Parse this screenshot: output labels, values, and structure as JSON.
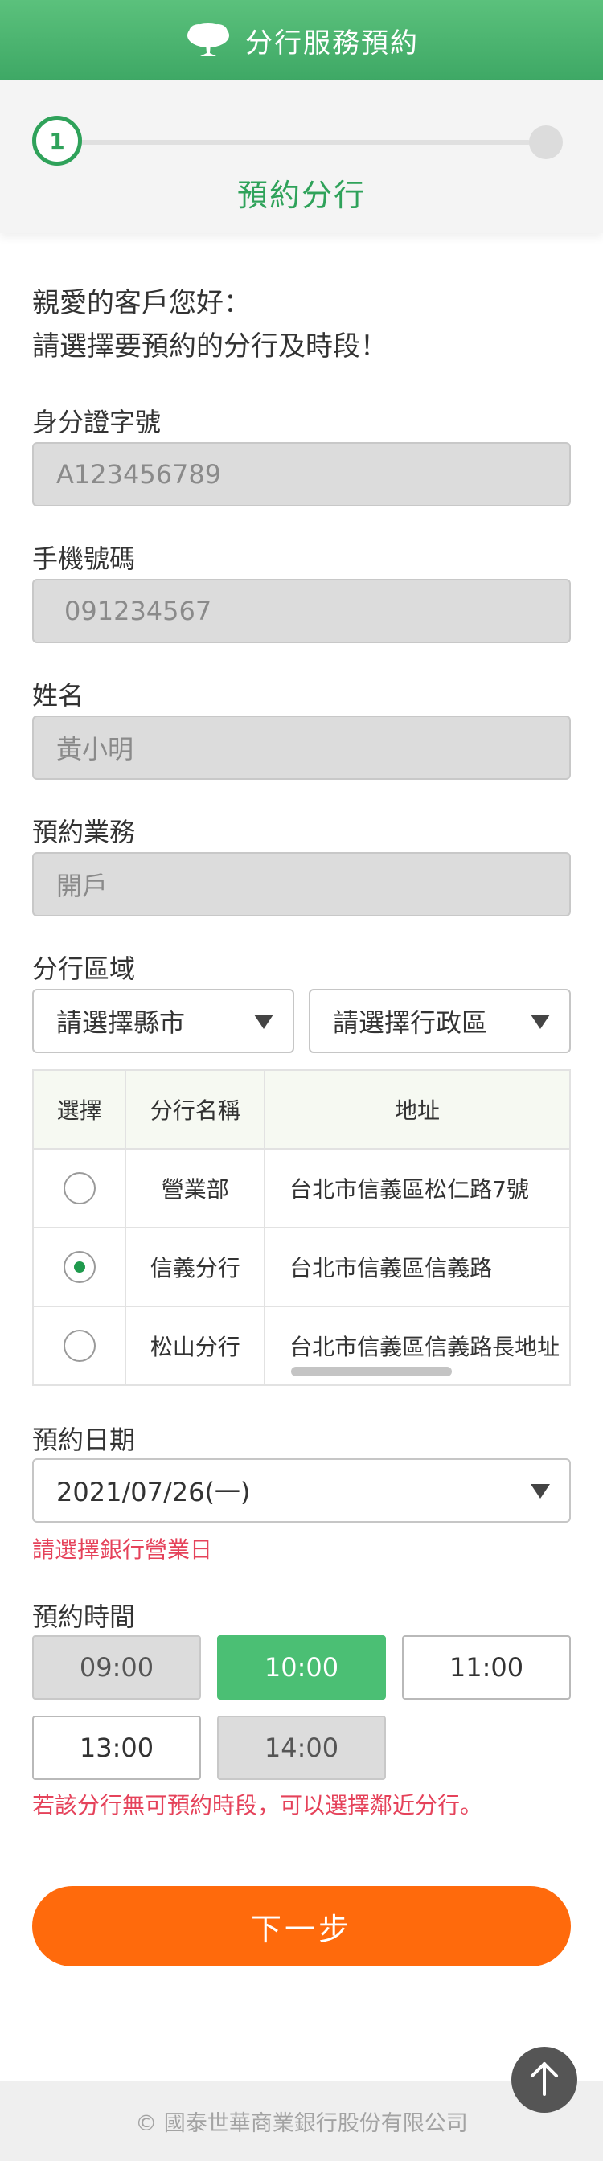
{
  "header": {
    "title": "分行服務預約",
    "logo_icon": "tree-logo-icon"
  },
  "stepper": {
    "step1_number": "1",
    "step1_label": "預約分行"
  },
  "greeting": {
    "line1": "親愛的客戶您好：",
    "line2": "請選擇要預約的分行及時段！"
  },
  "fields": {
    "id_label": "身分證字號",
    "id_value": "A123456789",
    "phone_label": "手機號碼",
    "phone_value": "091234567",
    "name_label": "姓名",
    "name_value": "黃小明",
    "service_label": "預約業務",
    "service_value": "開戶"
  },
  "region": {
    "label": "分行區域",
    "city_placeholder": "請選擇縣市",
    "district_placeholder": "請選擇行政區"
  },
  "branch_table": {
    "headers": [
      "選擇",
      "分行名稱",
      "地址"
    ],
    "rows": [
      {
        "name": "營業部",
        "address": "台北市信義區松仁路7號",
        "selected": false
      },
      {
        "name": "信義分行",
        "address": "台北市信義區信義路",
        "selected": true
      },
      {
        "name": "松山分行",
        "address": "台北市信義區信義路長地址",
        "selected": false
      }
    ]
  },
  "date": {
    "label": "預約日期",
    "value": "2021/07/26(一)",
    "hint": "請選擇銀行營業日"
  },
  "time": {
    "label": "預約時間",
    "slots": [
      {
        "time": "09:00",
        "state": "disabled"
      },
      {
        "time": "10:00",
        "state": "active"
      },
      {
        "time": "11:00",
        "state": "normal"
      },
      {
        "time": "13:00",
        "state": "normal"
      },
      {
        "time": "14:00",
        "state": "disabled"
      }
    ],
    "hint": "若該分行無可預約時段，可以選擇鄰近分行。"
  },
  "actions": {
    "next_label": "下一步"
  },
  "footer": {
    "copyright": "© 國泰世華商業銀行股份有限公司"
  },
  "colors": {
    "brand_green": "#3ea865",
    "accent_orange": "#ff6a0c",
    "error_red": "#e5425a",
    "active_slot": "#4bbf74"
  }
}
